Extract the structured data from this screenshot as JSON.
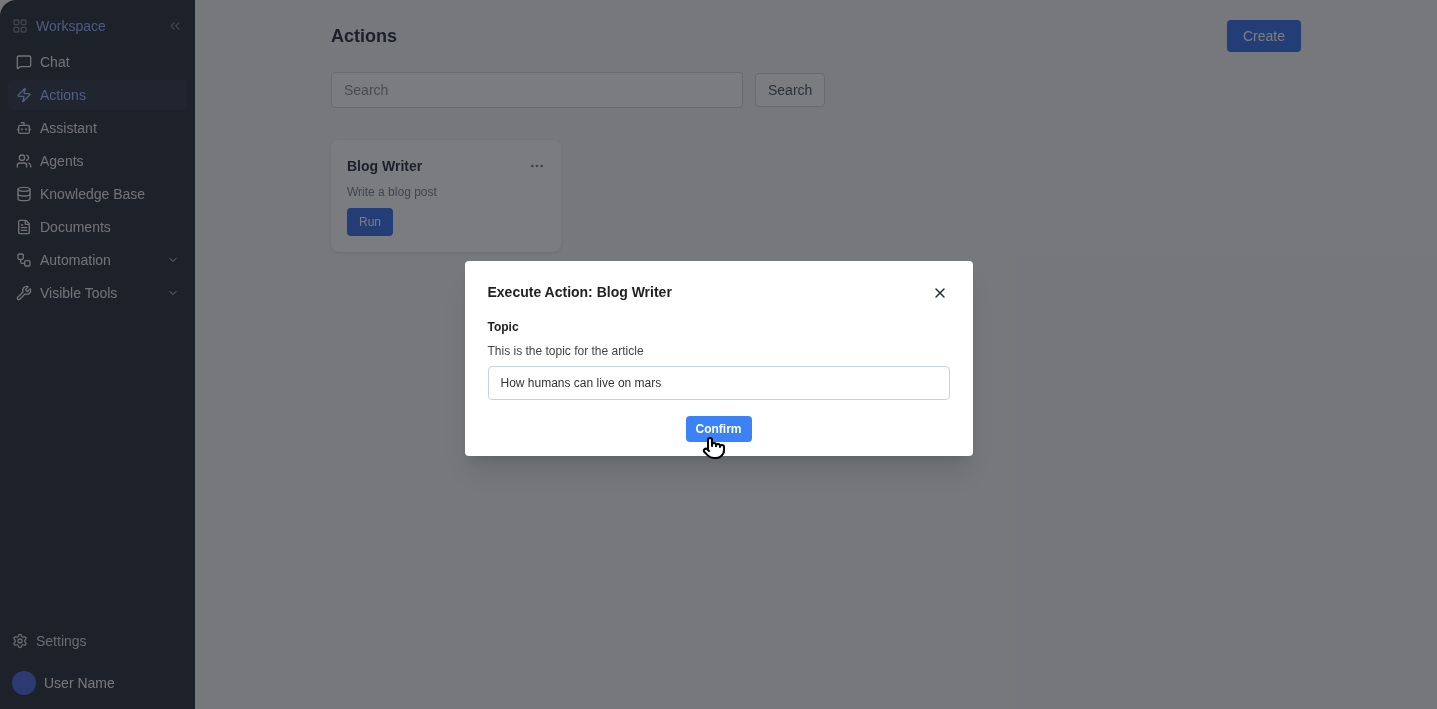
{
  "sidebar": {
    "brand": "Workspace",
    "items": [
      {
        "label": "Chat",
        "selected": false,
        "expandable": false
      },
      {
        "label": "Actions",
        "selected": true,
        "expandable": false
      },
      {
        "label": "Assistant",
        "selected": false,
        "expandable": false
      },
      {
        "label": "Agents",
        "selected": false,
        "expandable": false
      },
      {
        "label": "Knowledge Base",
        "selected": false,
        "expandable": false
      },
      {
        "label": "Documents",
        "selected": false,
        "expandable": false
      },
      {
        "label": "Automation",
        "selected": false,
        "expandable": true
      },
      {
        "label": "Visible Tools",
        "selected": false,
        "expandable": true
      }
    ],
    "settings": "Settings",
    "user": "User Name"
  },
  "page": {
    "title": "Actions",
    "create_button": "Create",
    "search": {
      "placeholder": "Search"
    },
    "search_button": "Search",
    "cards": [
      {
        "title": "Blog Writer",
        "description": "Write a blog post",
        "run_button": "Run"
      }
    ]
  },
  "dialog": {
    "title": "Execute Action: Blog Writer",
    "field_label": "Topic",
    "field_help": "This is the topic for the article",
    "field_value": "How humans can live on mars",
    "confirm_button": "Confirm"
  }
}
